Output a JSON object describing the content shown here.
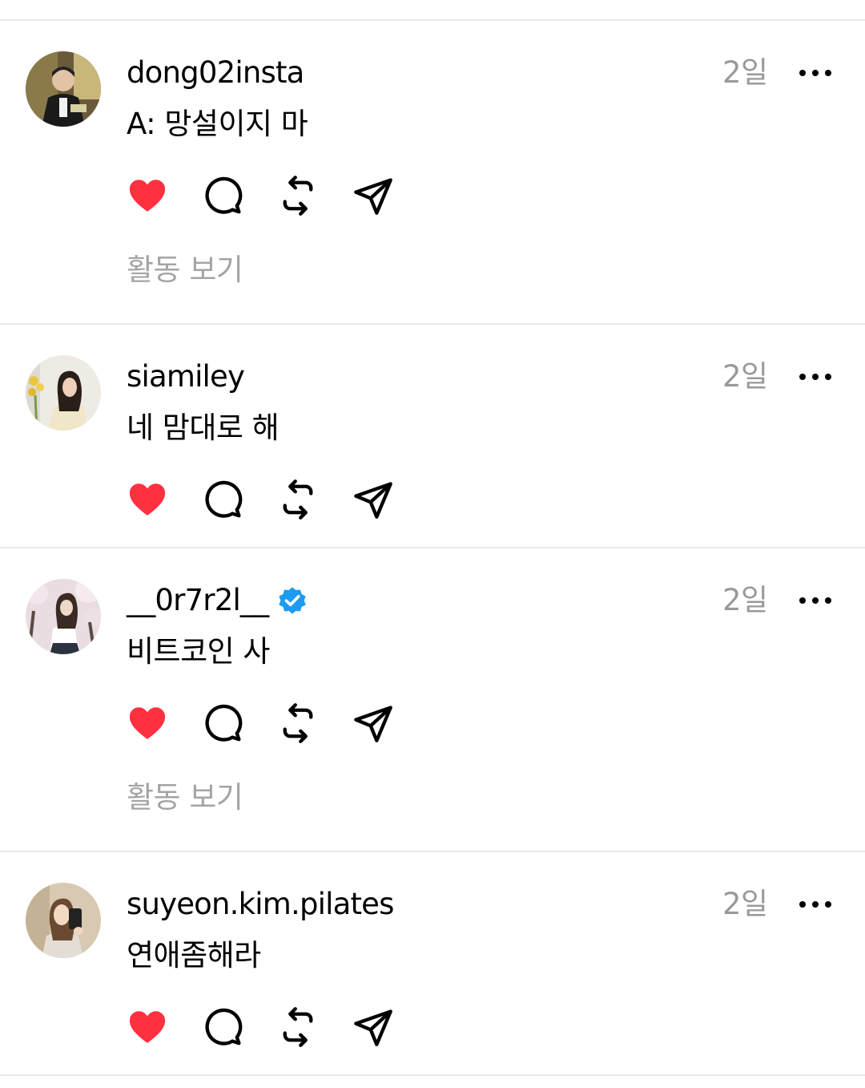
{
  "colors": {
    "like": "#FF3040",
    "muted": "#999999",
    "verified": "#1D9BF0",
    "divider": "#e8e8e8"
  },
  "icons": {
    "like": "heart-icon",
    "reply": "comment-icon",
    "repost": "repost-icon",
    "share": "send-icon",
    "more": "more-dots-icon",
    "verified": "verified-badge-icon"
  },
  "posts": [
    {
      "username": "dong02insta",
      "time": "2일",
      "text": "A: 망설이지 마",
      "verified": false,
      "liked": true,
      "activity_label": "활동 보기"
    },
    {
      "username": "siamiley",
      "time": "2일",
      "text": "네 맘대로 해",
      "verified": false,
      "liked": true,
      "activity_label": ""
    },
    {
      "username": "__0r7r2l__",
      "time": "2일",
      "text": "비트코인 사",
      "verified": true,
      "liked": true,
      "activity_label": "활동 보기"
    },
    {
      "username": "suyeon.kim.pilates",
      "time": "2일",
      "text": "연애좀해라",
      "verified": false,
      "liked": true,
      "activity_label": ""
    }
  ]
}
